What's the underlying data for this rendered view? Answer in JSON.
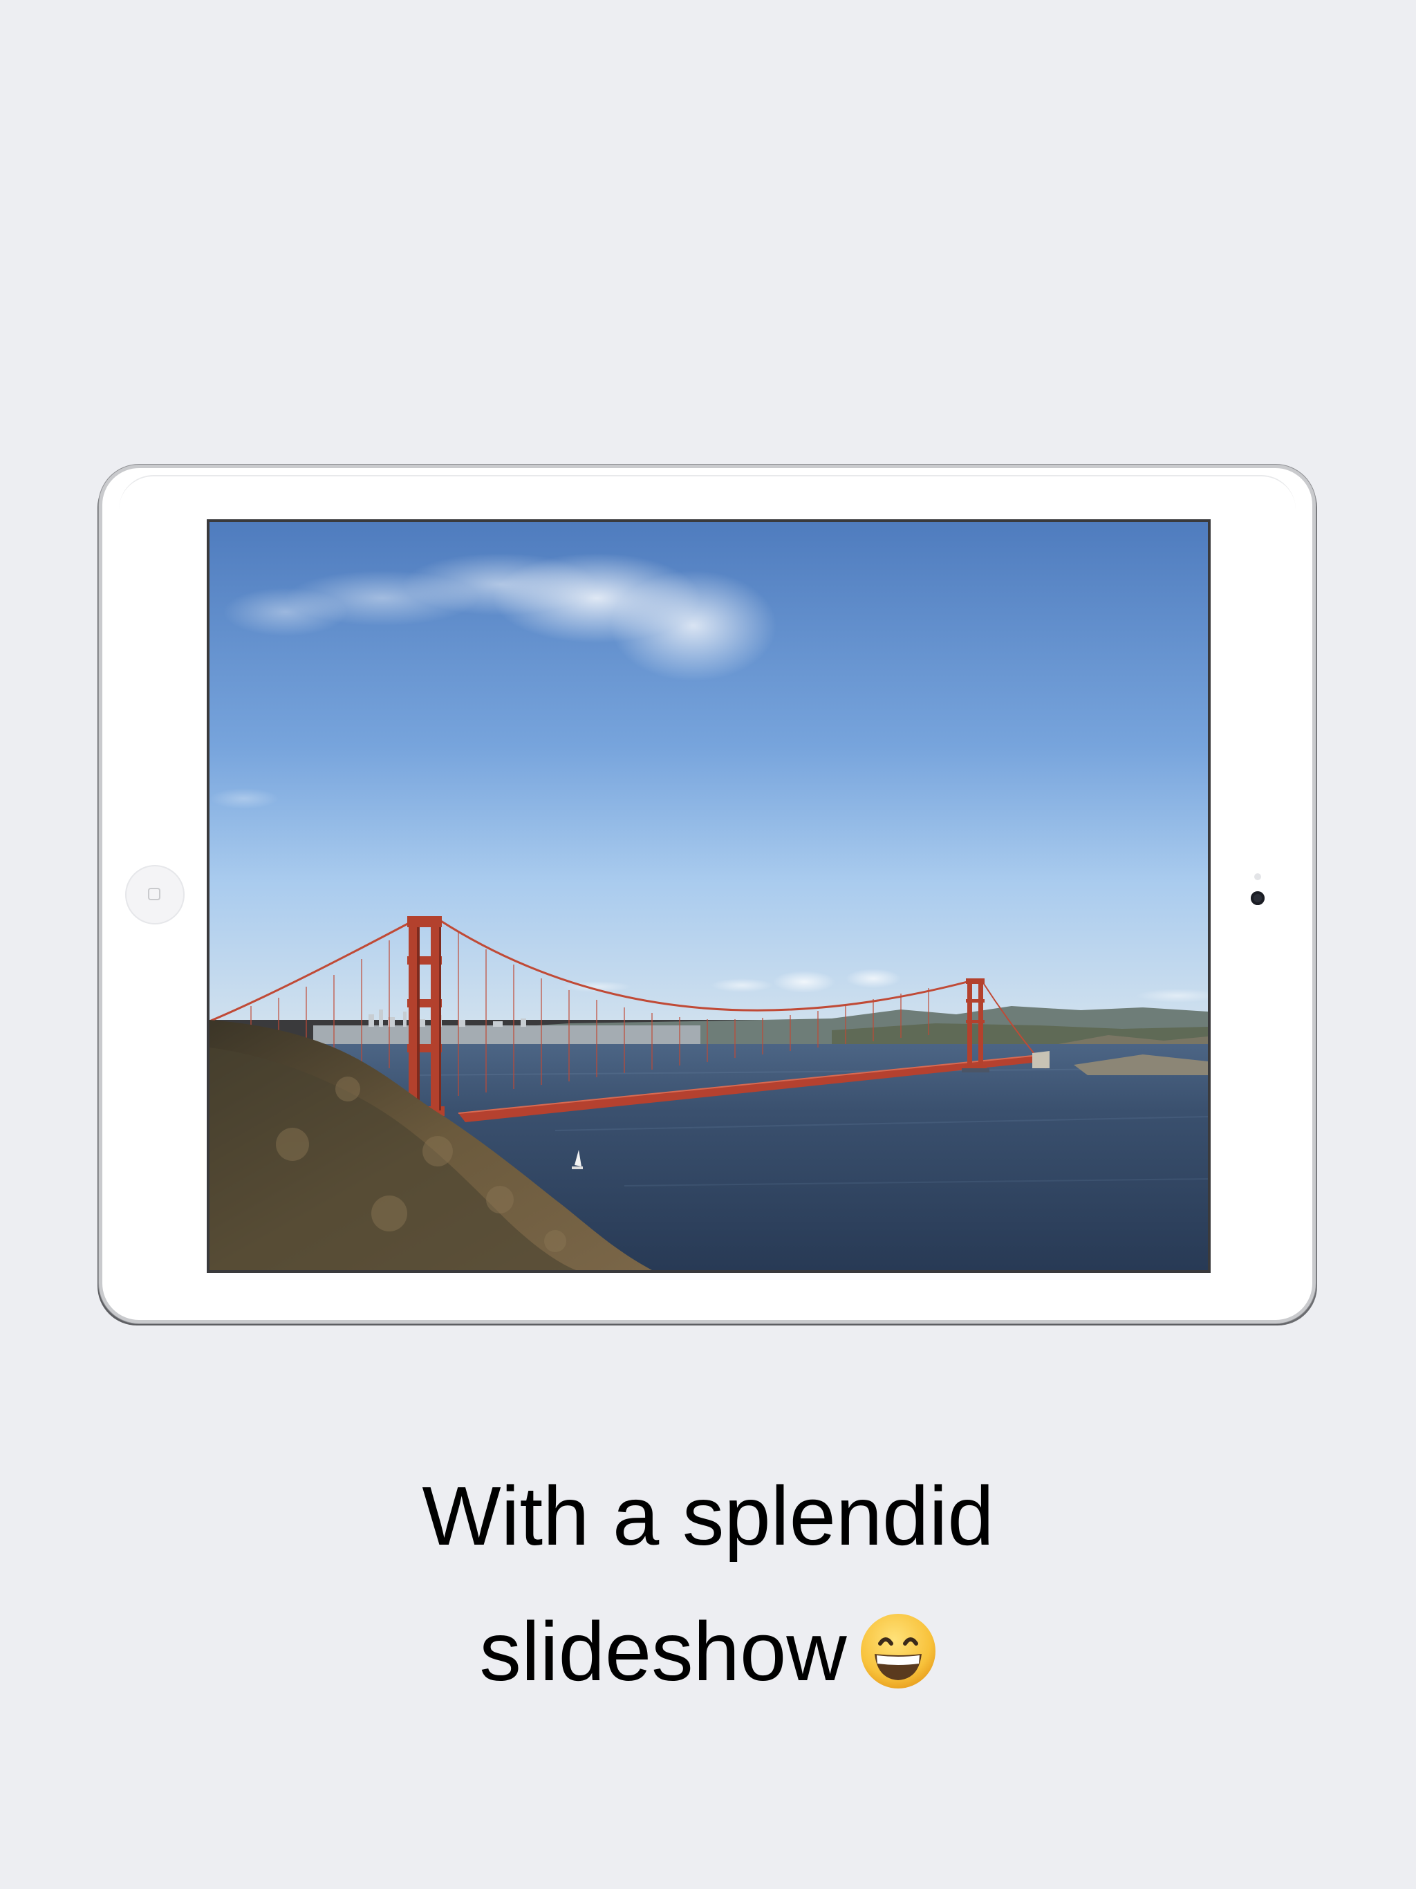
{
  "caption": {
    "line1": "With a splendid",
    "line2": "slideshow",
    "emoji": "grinning-face-icon"
  },
  "device": {
    "model": "iPad",
    "orientation": "landscape",
    "color": "#ffffff"
  },
  "slideshow": {
    "photo": "golden-gate-bridge-photo"
  },
  "colors": {
    "background": "#edeef2",
    "sky_top": "#4f79b9",
    "bridge": "#b5412f",
    "water": "#34465f"
  }
}
